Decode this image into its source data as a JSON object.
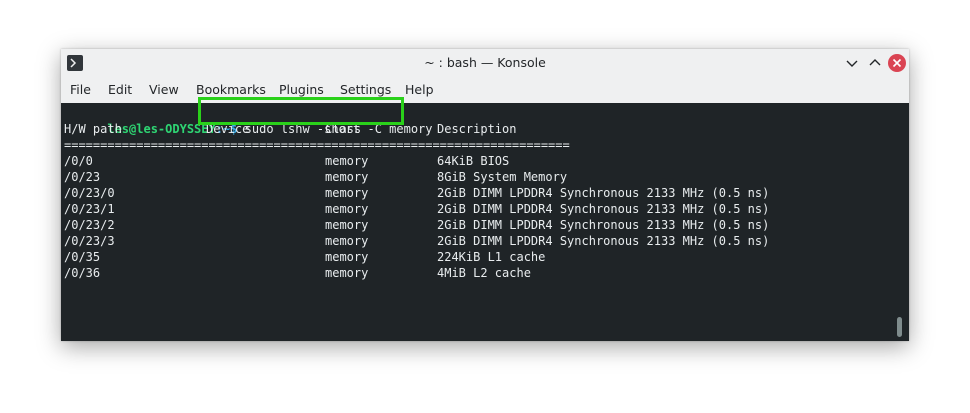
{
  "window": {
    "title": "~ : bash — Konsole",
    "close_color": "#da4453",
    "icons": {
      "app": "terminal-icon",
      "minimize": "chevron-down-icon",
      "maximize": "chevron-up-icon",
      "close": "close-icon"
    }
  },
  "menu": {
    "items": [
      "File",
      "Edit",
      "View",
      "Bookmarks",
      "Plugins",
      "Settings",
      "Help"
    ]
  },
  "terminal": {
    "prompt_user": "les@les-ODYSSEY",
    "prompt_dir": ":~$",
    "command": " sudo lshw -short -C memory",
    "highlight_color": "#2ad11a",
    "headers": {
      "path": "H/W path",
      "device": "Device",
      "class": "Class",
      "description": "Description"
    },
    "separator": "======================================================================",
    "rows": [
      {
        "path": "/0/0",
        "device": "",
        "class": "memory",
        "description": "64KiB BIOS"
      },
      {
        "path": "/0/23",
        "device": "",
        "class": "memory",
        "description": "8GiB System Memory"
      },
      {
        "path": "/0/23/0",
        "device": "",
        "class": "memory",
        "description": "2GiB DIMM LPDDR4 Synchronous 2133 MHz (0.5 ns)"
      },
      {
        "path": "/0/23/1",
        "device": "",
        "class": "memory",
        "description": "2GiB DIMM LPDDR4 Synchronous 2133 MHz (0.5 ns)"
      },
      {
        "path": "/0/23/2",
        "device": "",
        "class": "memory",
        "description": "2GiB DIMM LPDDR4 Synchronous 2133 MHz (0.5 ns)"
      },
      {
        "path": "/0/23/3",
        "device": "",
        "class": "memory",
        "description": "2GiB DIMM LPDDR4 Synchronous 2133 MHz (0.5 ns)"
      },
      {
        "path": "/0/35",
        "device": "",
        "class": "memory",
        "description": "224KiB L1 cache"
      },
      {
        "path": "/0/36",
        "device": "",
        "class": "memory",
        "description": "4MiB L2 cache"
      }
    ],
    "final_prompt_dir": ":~$"
  }
}
